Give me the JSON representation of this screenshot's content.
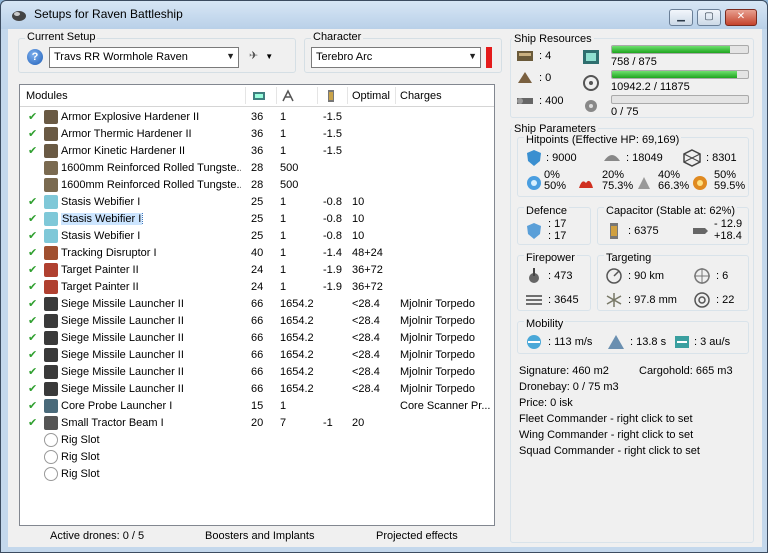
{
  "window": {
    "title": "Setups for Raven Battleship"
  },
  "setup": {
    "label": "Current Setup",
    "value": "Travs  RR Wormhole Raven"
  },
  "character": {
    "label": "Character",
    "value": "Terebro Arc"
  },
  "modules": {
    "headers": {
      "modules": "Modules",
      "optimal": "Optimal",
      "charges": "Charges"
    },
    "rows": [
      {
        "check": "✔",
        "name": "Armor Explosive Hardener II",
        "c1": "36",
        "c2": "1",
        "c3": "-1.5",
        "optimal": "",
        "charges": "",
        "icon": "#6a5a44"
      },
      {
        "check": "✔",
        "name": "Armor Thermic Hardener II",
        "c1": "36",
        "c2": "1",
        "c3": "-1.5",
        "optimal": "",
        "charges": "",
        "icon": "#6a5a44"
      },
      {
        "check": "✔",
        "name": "Armor Kinetic Hardener II",
        "c1": "36",
        "c2": "1",
        "c3": "-1.5",
        "optimal": "",
        "charges": "",
        "icon": "#6a5a44"
      },
      {
        "check": "",
        "name": "1600mm Reinforced Rolled Tungste...",
        "c1": "28",
        "c2": "500",
        "c3": "",
        "optimal": "",
        "charges": "",
        "icon": "#7a6a50"
      },
      {
        "check": "",
        "name": "1600mm Reinforced Rolled Tungste...",
        "c1": "28",
        "c2": "500",
        "c3": "",
        "optimal": "",
        "charges": "",
        "icon": "#7a6a50"
      },
      {
        "check": "✔",
        "name": "Stasis Webifier I",
        "c1": "25",
        "c2": "1",
        "c3": "-0.8",
        "optimal": "10",
        "charges": "",
        "icon": "#7fc8d8"
      },
      {
        "check": "✔",
        "name": "Stasis Webifier I",
        "c1": "25",
        "c2": "1",
        "c3": "-0.8",
        "optimal": "10",
        "charges": "",
        "icon": "#7fc8d8"
      },
      {
        "check": "✔",
        "name": "Stasis Webifier I",
        "c1": "25",
        "c2": "1",
        "c3": "-0.8",
        "optimal": "10",
        "charges": "",
        "icon": "#7fc8d8"
      },
      {
        "check": "✔",
        "name": "Tracking Disruptor I",
        "c1": "40",
        "c2": "1",
        "c3": "-1.4",
        "optimal": "48+24",
        "charges": "",
        "icon": "#a05030"
      },
      {
        "check": "✔",
        "name": "Target Painter II",
        "c1": "24",
        "c2": "1",
        "c3": "-1.9",
        "optimal": "36+72",
        "charges": "",
        "icon": "#b04030"
      },
      {
        "check": "✔",
        "name": "Target Painter II",
        "c1": "24",
        "c2": "1",
        "c3": "-1.9",
        "optimal": "36+72",
        "charges": "",
        "icon": "#b04030"
      },
      {
        "check": "✔",
        "name": "Siege Missile Launcher II",
        "c1": "66",
        "c2": "1654.2",
        "c3": "",
        "optimal": "<28.4",
        "charges": "Mjolnir Torpedo",
        "icon": "#3a3a3a"
      },
      {
        "check": "✔",
        "name": "Siege Missile Launcher II",
        "c1": "66",
        "c2": "1654.2",
        "c3": "",
        "optimal": "<28.4",
        "charges": "Mjolnir Torpedo",
        "icon": "#3a3a3a"
      },
      {
        "check": "✔",
        "name": "Siege Missile Launcher II",
        "c1": "66",
        "c2": "1654.2",
        "c3": "",
        "optimal": "<28.4",
        "charges": "Mjolnir Torpedo",
        "icon": "#3a3a3a"
      },
      {
        "check": "✔",
        "name": "Siege Missile Launcher II",
        "c1": "66",
        "c2": "1654.2",
        "c3": "",
        "optimal": "<28.4",
        "charges": "Mjolnir Torpedo",
        "icon": "#3a3a3a"
      },
      {
        "check": "✔",
        "name": "Siege Missile Launcher II",
        "c1": "66",
        "c2": "1654.2",
        "c3": "",
        "optimal": "<28.4",
        "charges": "Mjolnir Torpedo",
        "icon": "#3a3a3a"
      },
      {
        "check": "✔",
        "name": "Siege Missile Launcher II",
        "c1": "66",
        "c2": "1654.2",
        "c3": "",
        "optimal": "<28.4",
        "charges": "Mjolnir Torpedo",
        "icon": "#3a3a3a"
      },
      {
        "check": "✔",
        "name": "Core Probe Launcher I",
        "c1": "15",
        "c2": "1",
        "c3": "",
        "optimal": "",
        "charges": "Core Scanner Pr...",
        "icon": "#4a6a7a"
      },
      {
        "check": "✔",
        "name": "Small Tractor Beam I",
        "c1": "20",
        "c2": "7",
        "c3": "-1",
        "optimal": "20",
        "charges": "",
        "icon": "#555555"
      },
      {
        "check": "",
        "name": "Rig Slot",
        "c1": "",
        "c2": "",
        "c3": "",
        "optimal": "",
        "charges": "",
        "icon": "rig"
      },
      {
        "check": "",
        "name": "Rig Slot",
        "c1": "",
        "c2": "",
        "c3": "",
        "optimal": "",
        "charges": "",
        "icon": "rig"
      },
      {
        "check": "",
        "name": "Rig Slot",
        "c1": "",
        "c2": "",
        "c3": "",
        "optimal": "",
        "charges": "",
        "icon": "rig"
      }
    ],
    "selected_row": 6
  },
  "status": {
    "drones": "Active drones: 0 / 5",
    "boosters": "Boosters and Implants",
    "projected": "Projected effects"
  },
  "resources": {
    "title": "Ship Resources",
    "hi_slots": ": 4",
    "turret_slots": ": 0",
    "drone_bandwidth": ": 400",
    "cpu": "758 / 875",
    "cpu_fraction": 0.866,
    "powergrid": "10942.2 / 11875",
    "powergrid_fraction": 0.921,
    "calibration": "0 / 75",
    "calibration_fraction": 0
  },
  "parameters": {
    "title": "Ship Parameters",
    "hitpoints_title": "Hitpoints (Effective HP: 69,169)",
    "shield_hp": ": 9000",
    "armor_hp": ": 18049",
    "structure_hp": ": 8301",
    "res_row1": [
      "0%",
      "20%",
      "40%",
      "50%"
    ],
    "res_row2": [
      "50%",
      "75.3%",
      "66.3%",
      "59.5%"
    ],
    "defence_title": "Defence",
    "defence_1": ": 17",
    "defence_2": ": 17",
    "capacitor_title": "Capacitor (Stable at: 62%)",
    "capacitor_value": ": 6375",
    "capacitor_delta_1": "- 12.9",
    "capacitor_delta_2": "+18.4",
    "firepower_title": "Firepower",
    "firepower_1": ": 473",
    "firepower_2": ": 3645",
    "targeting_title": "Targeting",
    "target_range": ": 90 km",
    "max_targets": ": 6",
    "scan_res": ": 97.8 mm",
    "sensor_strength": ": 22",
    "mobility_title": "Mobility",
    "velocity": ": 113 m/s",
    "align_time": ": 13.8 s",
    "warp_speed": ": 3 au/s"
  },
  "info": {
    "signature": "Signature: 460 m2",
    "cargohold": "Cargohold: 665 m3",
    "dronebay": "Dronebay: 0 / 75 m3",
    "price": "Price: 0 isk",
    "fleet": "Fleet Commander - right click to set",
    "wing": "Wing Commander - right click to set",
    "squad": "Squad Commander - right click to set"
  }
}
